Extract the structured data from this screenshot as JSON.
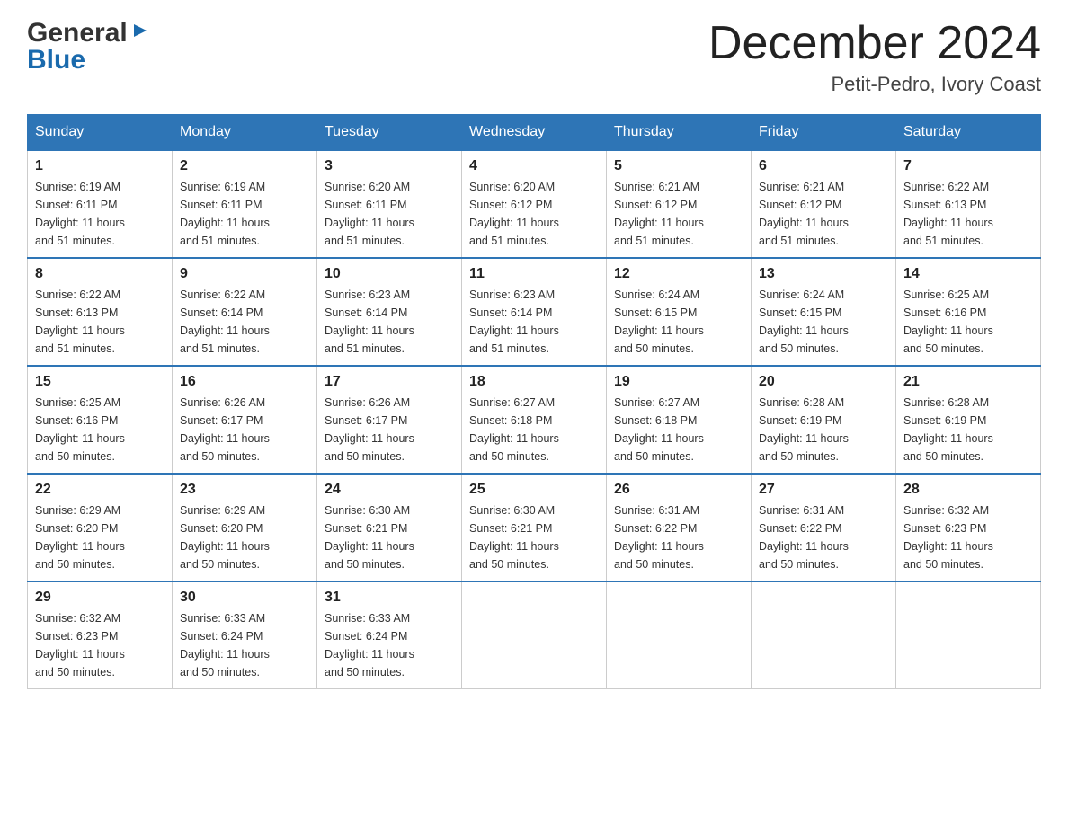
{
  "logo": {
    "part1": "General",
    "part2": "Blue"
  },
  "title": {
    "month_year": "December 2024",
    "location": "Petit-Pedro, Ivory Coast"
  },
  "weekdays": [
    "Sunday",
    "Monday",
    "Tuesday",
    "Wednesday",
    "Thursday",
    "Friday",
    "Saturday"
  ],
  "weeks": [
    [
      {
        "day": "1",
        "sunrise": "6:19 AM",
        "sunset": "6:11 PM",
        "daylight": "11 hours and 51 minutes."
      },
      {
        "day": "2",
        "sunrise": "6:19 AM",
        "sunset": "6:11 PM",
        "daylight": "11 hours and 51 minutes."
      },
      {
        "day": "3",
        "sunrise": "6:20 AM",
        "sunset": "6:11 PM",
        "daylight": "11 hours and 51 minutes."
      },
      {
        "day": "4",
        "sunrise": "6:20 AM",
        "sunset": "6:12 PM",
        "daylight": "11 hours and 51 minutes."
      },
      {
        "day": "5",
        "sunrise": "6:21 AM",
        "sunset": "6:12 PM",
        "daylight": "11 hours and 51 minutes."
      },
      {
        "day": "6",
        "sunrise": "6:21 AM",
        "sunset": "6:12 PM",
        "daylight": "11 hours and 51 minutes."
      },
      {
        "day": "7",
        "sunrise": "6:22 AM",
        "sunset": "6:13 PM",
        "daylight": "11 hours and 51 minutes."
      }
    ],
    [
      {
        "day": "8",
        "sunrise": "6:22 AM",
        "sunset": "6:13 PM",
        "daylight": "11 hours and 51 minutes."
      },
      {
        "day": "9",
        "sunrise": "6:22 AM",
        "sunset": "6:14 PM",
        "daylight": "11 hours and 51 minutes."
      },
      {
        "day": "10",
        "sunrise": "6:23 AM",
        "sunset": "6:14 PM",
        "daylight": "11 hours and 51 minutes."
      },
      {
        "day": "11",
        "sunrise": "6:23 AM",
        "sunset": "6:14 PM",
        "daylight": "11 hours and 51 minutes."
      },
      {
        "day": "12",
        "sunrise": "6:24 AM",
        "sunset": "6:15 PM",
        "daylight": "11 hours and 50 minutes."
      },
      {
        "day": "13",
        "sunrise": "6:24 AM",
        "sunset": "6:15 PM",
        "daylight": "11 hours and 50 minutes."
      },
      {
        "day": "14",
        "sunrise": "6:25 AM",
        "sunset": "6:16 PM",
        "daylight": "11 hours and 50 minutes."
      }
    ],
    [
      {
        "day": "15",
        "sunrise": "6:25 AM",
        "sunset": "6:16 PM",
        "daylight": "11 hours and 50 minutes."
      },
      {
        "day": "16",
        "sunrise": "6:26 AM",
        "sunset": "6:17 PM",
        "daylight": "11 hours and 50 minutes."
      },
      {
        "day": "17",
        "sunrise": "6:26 AM",
        "sunset": "6:17 PM",
        "daylight": "11 hours and 50 minutes."
      },
      {
        "day": "18",
        "sunrise": "6:27 AM",
        "sunset": "6:18 PM",
        "daylight": "11 hours and 50 minutes."
      },
      {
        "day": "19",
        "sunrise": "6:27 AM",
        "sunset": "6:18 PM",
        "daylight": "11 hours and 50 minutes."
      },
      {
        "day": "20",
        "sunrise": "6:28 AM",
        "sunset": "6:19 PM",
        "daylight": "11 hours and 50 minutes."
      },
      {
        "day": "21",
        "sunrise": "6:28 AM",
        "sunset": "6:19 PM",
        "daylight": "11 hours and 50 minutes."
      }
    ],
    [
      {
        "day": "22",
        "sunrise": "6:29 AM",
        "sunset": "6:20 PM",
        "daylight": "11 hours and 50 minutes."
      },
      {
        "day": "23",
        "sunrise": "6:29 AM",
        "sunset": "6:20 PM",
        "daylight": "11 hours and 50 minutes."
      },
      {
        "day": "24",
        "sunrise": "6:30 AM",
        "sunset": "6:21 PM",
        "daylight": "11 hours and 50 minutes."
      },
      {
        "day": "25",
        "sunrise": "6:30 AM",
        "sunset": "6:21 PM",
        "daylight": "11 hours and 50 minutes."
      },
      {
        "day": "26",
        "sunrise": "6:31 AM",
        "sunset": "6:22 PM",
        "daylight": "11 hours and 50 minutes."
      },
      {
        "day": "27",
        "sunrise": "6:31 AM",
        "sunset": "6:22 PM",
        "daylight": "11 hours and 50 minutes."
      },
      {
        "day": "28",
        "sunrise": "6:32 AM",
        "sunset": "6:23 PM",
        "daylight": "11 hours and 50 minutes."
      }
    ],
    [
      {
        "day": "29",
        "sunrise": "6:32 AM",
        "sunset": "6:23 PM",
        "daylight": "11 hours and 50 minutes."
      },
      {
        "day": "30",
        "sunrise": "6:33 AM",
        "sunset": "6:24 PM",
        "daylight": "11 hours and 50 minutes."
      },
      {
        "day": "31",
        "sunrise": "6:33 AM",
        "sunset": "6:24 PM",
        "daylight": "11 hours and 50 minutes."
      },
      null,
      null,
      null,
      null
    ]
  ]
}
